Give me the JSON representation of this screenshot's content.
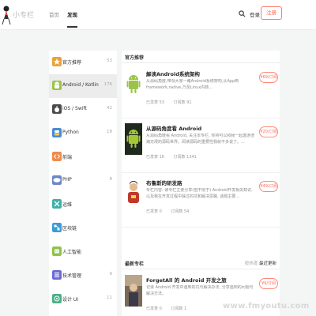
{
  "header": {
    "logo_text": "小专栏",
    "nav_home": "首页",
    "nav_discover": "发现",
    "login": "登录",
    "register": "注册"
  },
  "sidebar": {
    "items": [
      {
        "label": "官方推荐",
        "count": "53",
        "color": "#e9a23b",
        "icon": "star-icon"
      },
      {
        "label": "Android / Kotlin",
        "count": "176",
        "color": "#9bc34a",
        "icon": "android-icon"
      },
      {
        "label": "iOS / Swift",
        "count": "42",
        "color": "#4a4a4a",
        "icon": "apple-icon"
      },
      {
        "label": "Python",
        "count": "18",
        "color": "#4a8bd6",
        "icon": "python-icon"
      },
      {
        "label": "前端",
        "count": "",
        "color": "#f08a4b",
        "icon": "code-icon"
      },
      {
        "label": "PHP",
        "count": "8",
        "color": "#6b87c7",
        "icon": "php-icon"
      },
      {
        "label": "运维",
        "count": "",
        "color": "#3fb0a9",
        "icon": "tools-icon"
      },
      {
        "label": "区块链",
        "count": "",
        "color": "#3b9bd6",
        "icon": "blockchain-icon"
      },
      {
        "label": "人工智能",
        "count": "",
        "color": "#8fc24a",
        "icon": "ai-icon"
      },
      {
        "label": "技术管理",
        "count": "9",
        "color": "#6b6bd6",
        "icon": "management-icon"
      },
      {
        "label": "设计 UI",
        "count": "11",
        "color": "#4ab08a",
        "icon": "design-icon"
      }
    ]
  },
  "main": {
    "official_title": "官方推荐",
    "latest_title": "最新专栏",
    "tab_hot": "按热度",
    "tab_latest": "最近更新",
    "cards": [
      {
        "title": "解读Android系统架构",
        "desc": "从源码角度,带领大家一睹Android系统架构,从App到framework,native,乃至Linux内核...",
        "subscribers": "已发表 53",
        "readers": "订阅数 91",
        "price": "¥69/订阅",
        "icon": "android-robot-icon"
      },
      {
        "title": "从源码角度看 Android",
        "desc": "从源码角度看 Android, 关注本专栏, 你将可以和我一起遨游浩瀚无垠的源码世界。阅读源码的重要性我就不多说了。...",
        "subscribers": "已发表 16",
        "readers": "订阅数 1341",
        "price": "¥20/订阅",
        "icon": "android-robot-icon"
      },
      {
        "title": "布鲁斯的研发路",
        "desc": "专栏内容: 读专栏主要分享(但不限于) Android开发相关知识, 以及我在开发过程中踩过的坑和解决思路, 话题主要...",
        "subscribers": "已发表 0",
        "readers": "订阅数 54",
        "price": "¥49/订阅",
        "icon": "author-avatar-icon"
      },
      {
        "title": "ForgetAll 的 Android 开发之旅",
        "desc": "记录 Android 开发中遇到的坑与解决办法, 分享遇到的问题与解决方法。",
        "subscribers": "已发表 0",
        "readers": "订阅数 1",
        "price": "¥9/订阅",
        "icon": "author-photo-icon"
      }
    ]
  },
  "watermark": "www.fmyoutu.com"
}
